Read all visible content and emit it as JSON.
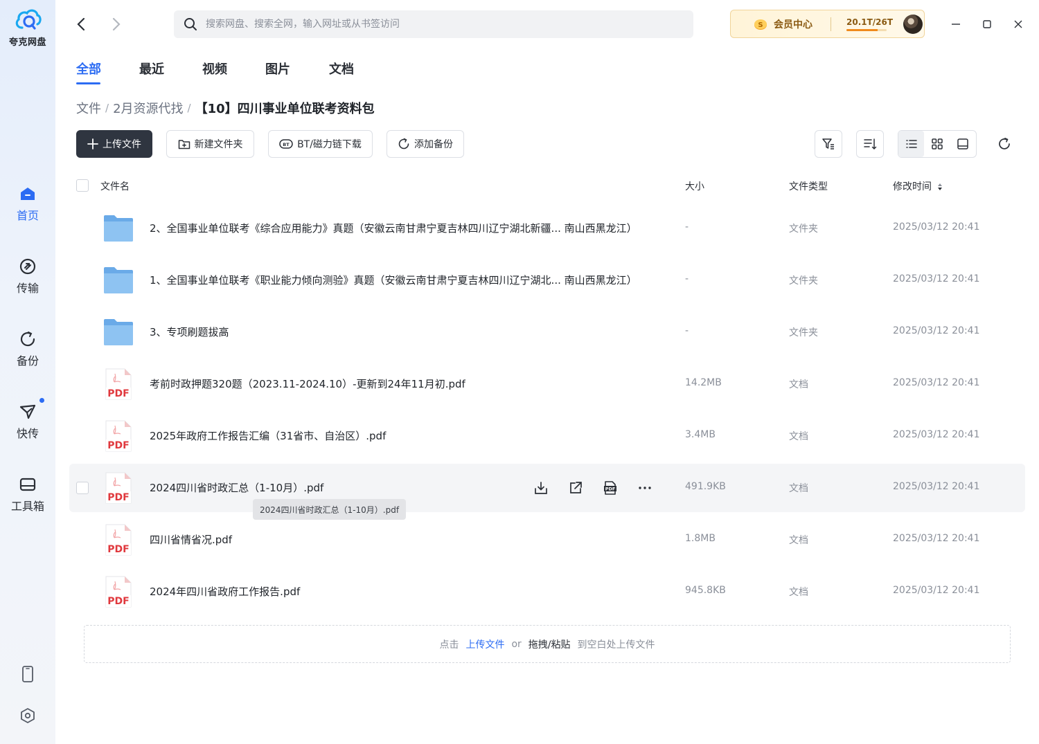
{
  "app": {
    "name": "夸克网盘"
  },
  "sidebar": {
    "items": [
      {
        "label": "首页",
        "active": true
      },
      {
        "label": "传输",
        "active": false
      },
      {
        "label": "备份",
        "active": false
      },
      {
        "label": "快传",
        "active": false,
        "badge_dot": true
      },
      {
        "label": "工具箱",
        "active": false
      }
    ]
  },
  "search": {
    "placeholder": "搜索网盘、搜索全网，输入网址或从书签访问"
  },
  "vip": {
    "label": "会员中心",
    "quota": "20.1T/26T",
    "quota_fraction": 0.77
  },
  "tabs": [
    {
      "label": "全部",
      "active": true
    },
    {
      "label": "最近",
      "active": false
    },
    {
      "label": "视频",
      "active": false
    },
    {
      "label": "图片",
      "active": false
    },
    {
      "label": "文档",
      "active": false
    }
  ],
  "breadcrumb": {
    "items": [
      "文件",
      "2月资源代找"
    ],
    "separator": "/",
    "current": "【10】四川事业单位联考资料包"
  },
  "toolbar": {
    "upload": "上传文件",
    "new_folder": "新建文件夹",
    "bt_download": "BT/磁力链下载",
    "add_backup": "添加备份"
  },
  "table": {
    "headers": {
      "name": "文件名",
      "size": "大小",
      "type": "文件类型",
      "time": "修改时间"
    },
    "rows": [
      {
        "kind": "folder",
        "name": "2、全国事业单位联考《综合应用能力》真题（安徽云南甘肃宁夏吉林四川辽宁湖北新疆...  南山西黑龙江）",
        "size": "-",
        "type": "文件夹",
        "time": "2025/03/12 20:41"
      },
      {
        "kind": "folder",
        "name": "1、全国事业单位联考《职业能力倾向测验》真题（安徽云南甘肃宁夏吉林四川辽宁湖北...  南山西黑龙江）",
        "size": "-",
        "type": "文件夹",
        "time": "2025/03/12 20:41"
      },
      {
        "kind": "folder",
        "name": "3、专项刷题拔高",
        "size": "-",
        "type": "文件夹",
        "time": "2025/03/12 20:41"
      },
      {
        "kind": "pdf",
        "name": "考前时政押题320题（2023.11-2024.10）-更新到24年11月初.pdf",
        "size": "14.2MB",
        "type": "文档",
        "time": "2025/03/12 20:41"
      },
      {
        "kind": "pdf",
        "name": "2025年政府工作报告汇编（31省市、自治区）.pdf",
        "size": "3.4MB",
        "type": "文档",
        "time": "2025/03/12 20:41"
      },
      {
        "kind": "pdf",
        "name": "2024四川省时政汇总（1-10月）.pdf",
        "size": "491.9KB",
        "type": "文档",
        "time": "2025/03/12 20:41",
        "hovered": true
      },
      {
        "kind": "pdf",
        "name": "四川省情省况.pdf",
        "size": "1.8MB",
        "type": "文档",
        "time": "2025/03/12 20:41"
      },
      {
        "kind": "pdf",
        "name": "2024年四川省政府工作报告.pdf",
        "size": "945.8KB",
        "type": "文档",
        "time": "2025/03/12 20:41"
      }
    ]
  },
  "tooltip": "2024四川省时政汇总（1-10月）.pdf",
  "pdf_icon_text": "PDF",
  "dropzone": {
    "prefix": "点击",
    "upload_link": "上传文件",
    "or": "or",
    "drag": "拖拽/粘贴",
    "suffix": "到空白处上传文件"
  },
  "colors": {
    "accent": "#2c6cf3",
    "folder": "#7fb8ef",
    "pdf_red": "#e0393e",
    "primary_button": "#2f3540"
  }
}
